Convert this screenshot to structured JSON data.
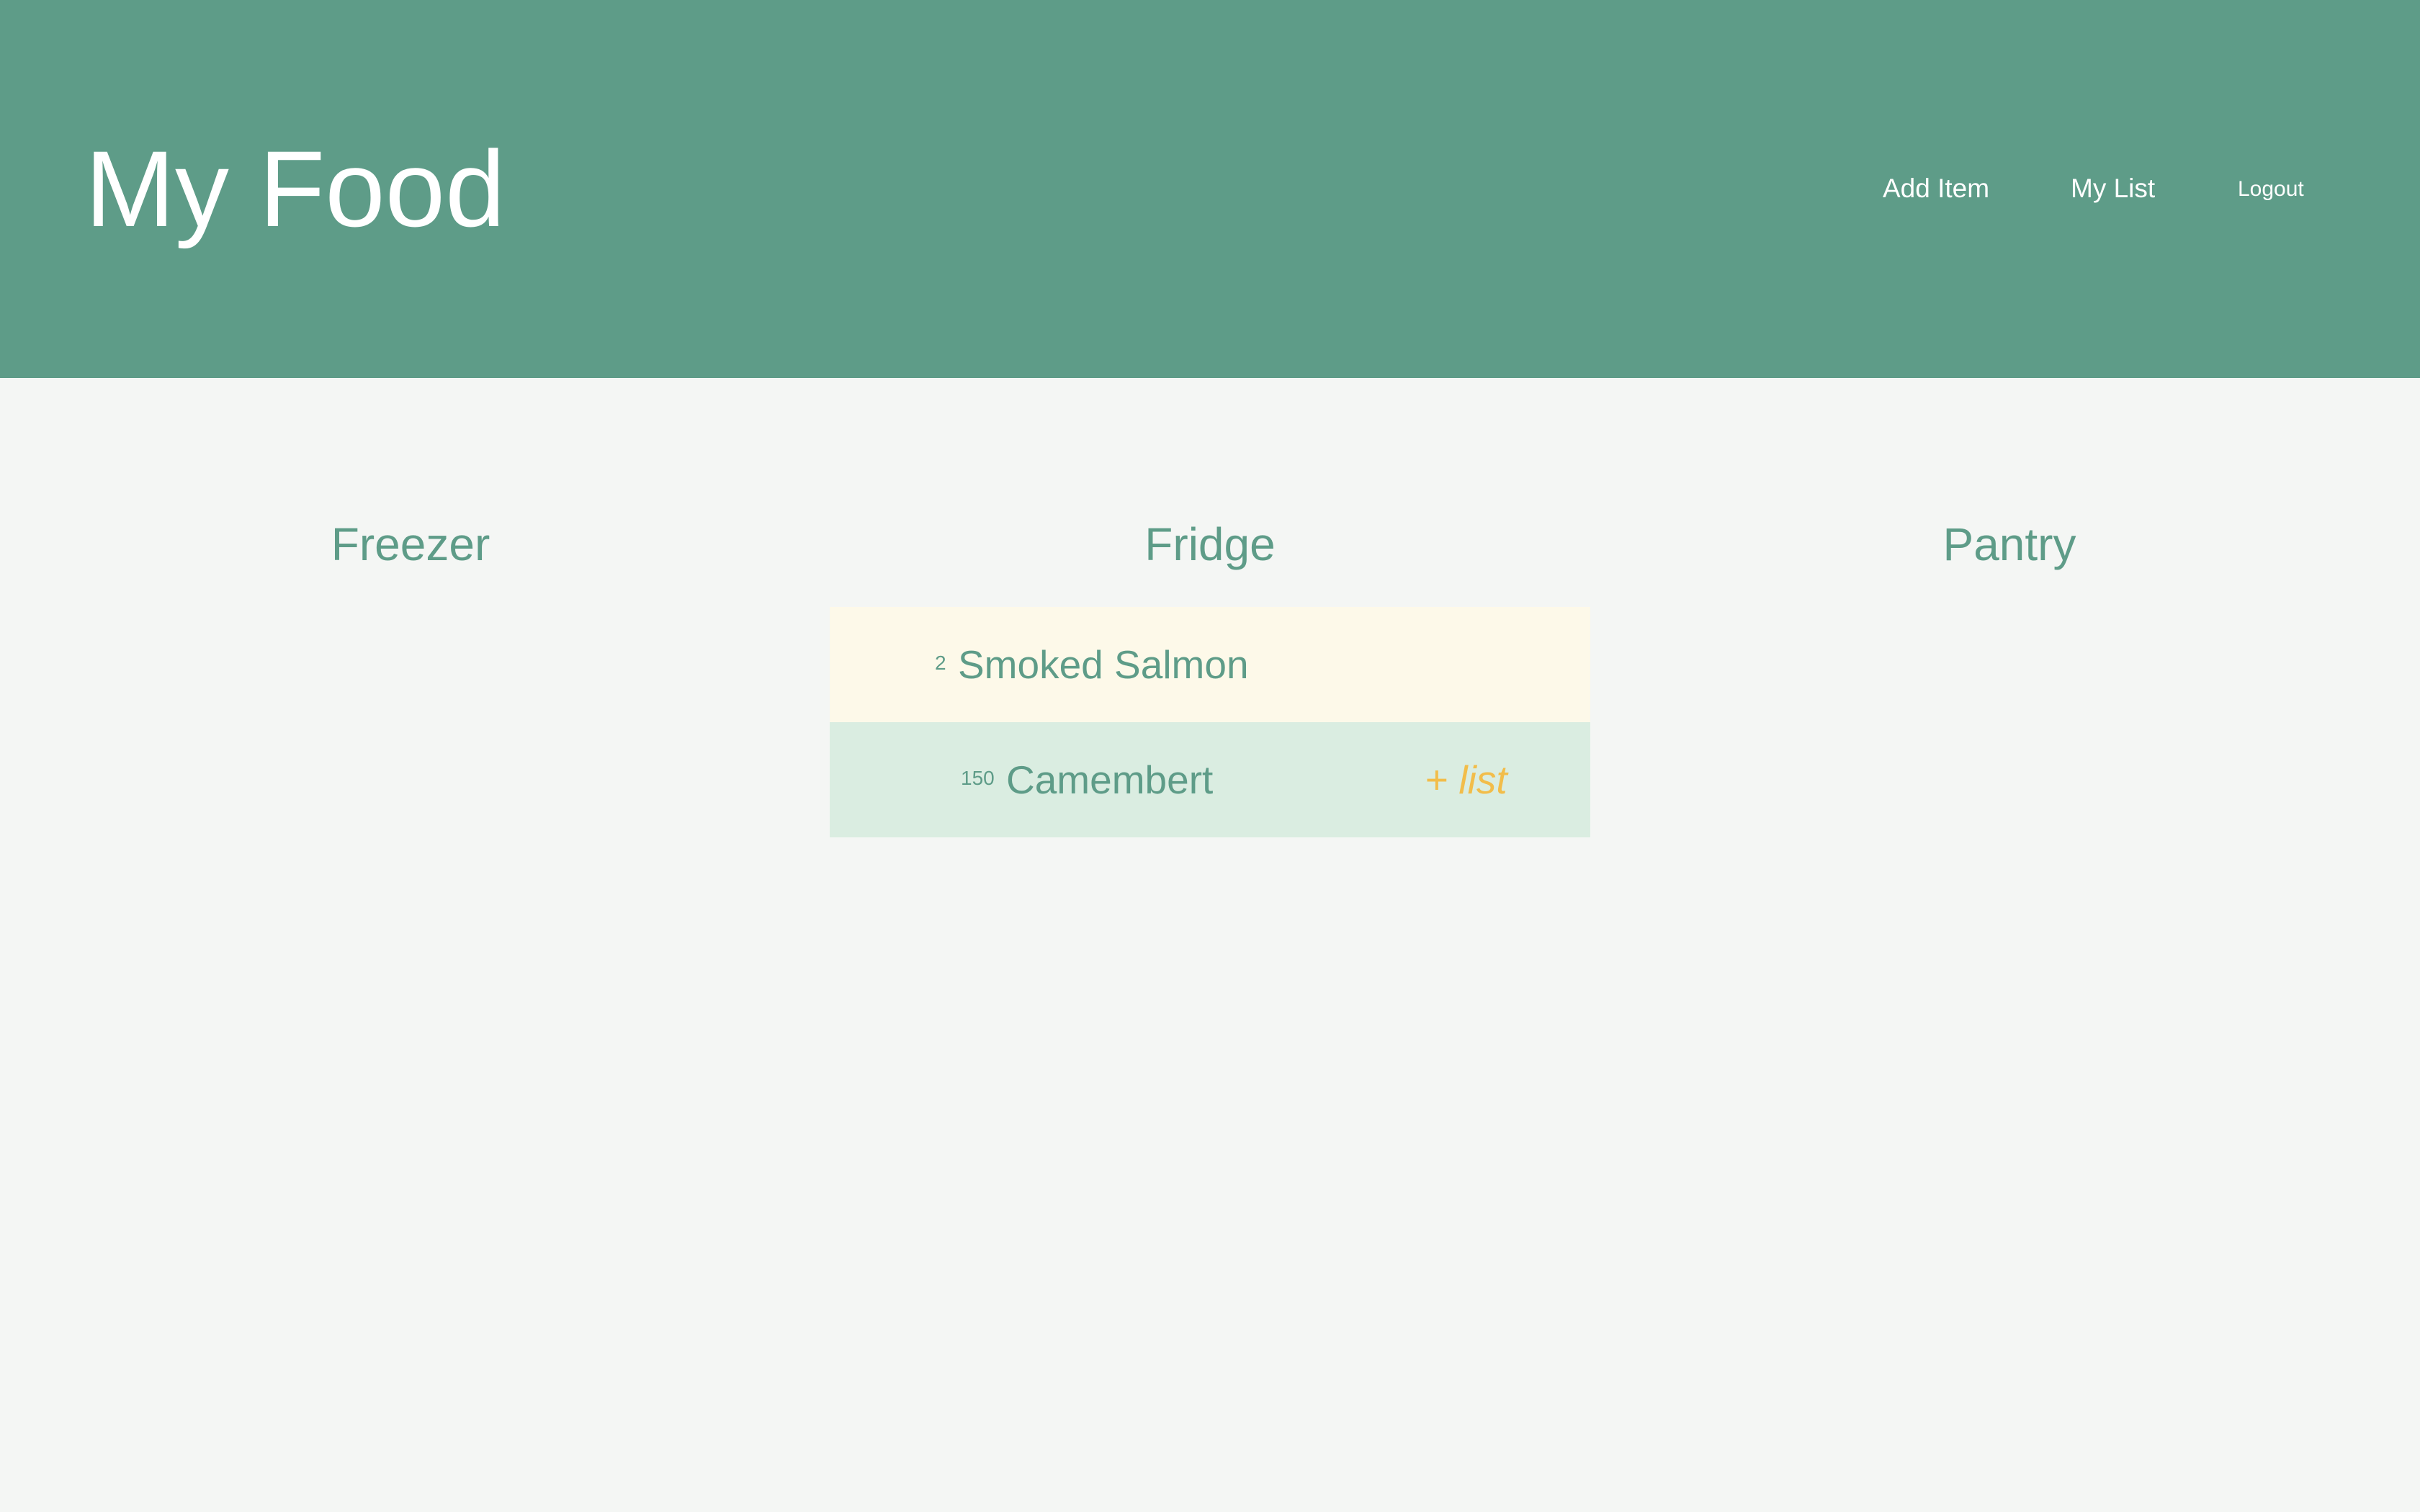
{
  "header": {
    "title": "My Food",
    "nav": {
      "add_item": "Add Item",
      "my_list": "My List",
      "logout": "Logout"
    }
  },
  "columns": {
    "freezer": {
      "heading": "Freezer"
    },
    "fridge": {
      "heading": "Fridge",
      "items": [
        {
          "quantity": "2",
          "name": "Smoked Salmon"
        },
        {
          "quantity": "150",
          "name": "Camembert",
          "action": "+ list"
        }
      ]
    },
    "pantry": {
      "heading": "Pantry"
    }
  },
  "colors": {
    "brand": "#5e9c88",
    "background": "#f4f6f4",
    "row_highlight": "#fdf9e9",
    "row_selected": "#daede1",
    "accent": "#f2bd4a"
  }
}
